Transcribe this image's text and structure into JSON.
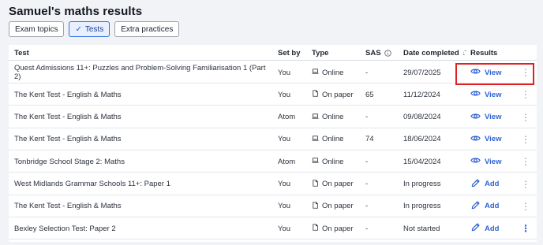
{
  "page": {
    "title": "Samuel's maths results"
  },
  "filters": [
    {
      "label": "Exam topics",
      "active": false
    },
    {
      "label": "Tests",
      "active": true,
      "check": "✓"
    },
    {
      "label": "Extra practices",
      "active": false
    }
  ],
  "table": {
    "headers": {
      "test": "Test",
      "set_by": "Set by",
      "type": "Type",
      "sas": "SAS",
      "date": "Date completed",
      "results": "Results"
    },
    "rows": [
      {
        "test": "Quest Admissions 11+: Puzzles and Problem-Solving Familiarisation 1 (Part 2)",
        "set_by": "You",
        "type": "Online",
        "type_icon": "laptop-icon",
        "sas": "-",
        "date": "29/07/2025",
        "result": "View",
        "result_icon": "eye-icon",
        "highlighted": true
      },
      {
        "test": "The Kent Test - English & Maths",
        "set_by": "You",
        "type": "On paper",
        "type_icon": "paper-icon",
        "sas": "65",
        "date": "11/12/2024",
        "result": "View",
        "result_icon": "eye-icon"
      },
      {
        "test": "The Kent Test - English & Maths",
        "set_by": "Atom",
        "type": "Online",
        "type_icon": "laptop-icon",
        "sas": "-",
        "date": "09/08/2024",
        "result": "View",
        "result_icon": "eye-icon"
      },
      {
        "test": "The Kent Test - English & Maths",
        "set_by": "You",
        "type": "Online",
        "type_icon": "laptop-icon",
        "sas": "74",
        "date": "18/06/2024",
        "result": "View",
        "result_icon": "eye-icon"
      },
      {
        "test": "Tonbridge School Stage 2: Maths",
        "set_by": "Atom",
        "type": "Online",
        "type_icon": "laptop-icon",
        "sas": "-",
        "date": "15/04/2024",
        "result": "View",
        "result_icon": "eye-icon"
      },
      {
        "test": "West Midlands Grammar Schools 11+: Paper 1",
        "set_by": "You",
        "type": "On paper",
        "type_icon": "paper-icon",
        "sas": "-",
        "date": "In progress",
        "result": "Add",
        "result_icon": "pencil-icon"
      },
      {
        "test": "The Kent Test - English & Maths",
        "set_by": "You",
        "type": "On paper",
        "type_icon": "paper-icon",
        "sas": "-",
        "date": "In progress",
        "result": "Add",
        "result_icon": "pencil-icon"
      },
      {
        "test": "Bexley Selection Test: Paper 2",
        "set_by": "You",
        "type": "On paper",
        "type_icon": "paper-icon",
        "sas": "-",
        "date": "Not started",
        "result": "Add",
        "result_icon": "pencil-icon"
      }
    ]
  },
  "colors": {
    "accent": "#2f63d6",
    "highlight": "#e0201f",
    "background": "#f1f3f7"
  }
}
